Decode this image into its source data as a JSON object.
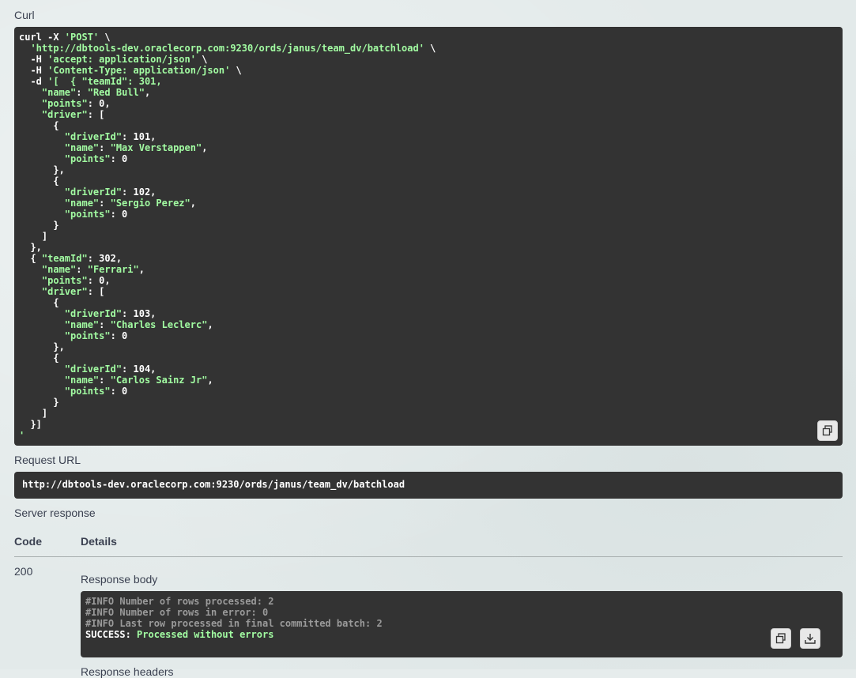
{
  "curl": {
    "label": "Curl",
    "lines": [
      "curl -X 'POST' \\",
      "  'http://dbtools-dev.oraclecorp.com:9230/ords/janus/team_dv/batchload' \\",
      "  -H 'accept: application/json' \\",
      "  -H 'Content-Type: application/json' \\",
      "  -d '[  { \"teamId\": 301,",
      "    \"name\": \"Red Bull\",",
      "    \"points\": 0,",
      "    \"driver\": [",
      "      {",
      "        \"driverId\": 101,",
      "        \"name\": \"Max Verstappen\",",
      "        \"points\": 0",
      "      },",
      "      {",
      "        \"driverId\": 102,",
      "        \"name\": \"Sergio Perez\",",
      "        \"points\": 0",
      "      }",
      "    ]",
      "  },",
      "  { \"teamId\": 302,",
      "    \"name\": \"Ferrari\",",
      "    \"points\": 0,",
      "    \"driver\": [",
      "      {",
      "        \"driverId\": 103,",
      "        \"name\": \"Charles Leclerc\",",
      "        \"points\": 0",
      "      },",
      "      {",
      "        \"driverId\": 104,",
      "        \"name\": \"Carlos Sainz Jr\",",
      "        \"points\": 0",
      "      }",
      "    ]",
      "  }]",
      "'"
    ],
    "copy_icon": "copy-icon"
  },
  "request_url": {
    "label": "Request URL",
    "value": "http://dbtools-dev.oraclecorp.com:9230/ords/janus/team_dv/batchload"
  },
  "server_response": {
    "label": "Server response",
    "col_code": "Code",
    "col_details": "Details",
    "code": "200",
    "body_label": "Response body",
    "info_lines": [
      "#INFO Number of rows processed: 2",
      "#INFO Number of rows in error: 0",
      "#INFO Last row processed in final committed batch: 2"
    ],
    "success_prefix": "SUCCESS:",
    "success_message": "Processed without errors",
    "copy_icon": "copy-icon",
    "download_icon": "download-icon",
    "next_label": "Response headers"
  },
  "colors": {
    "code_bg": "#333333",
    "string_green": "#a2fca2",
    "info_gray": "#9a9a9a"
  }
}
